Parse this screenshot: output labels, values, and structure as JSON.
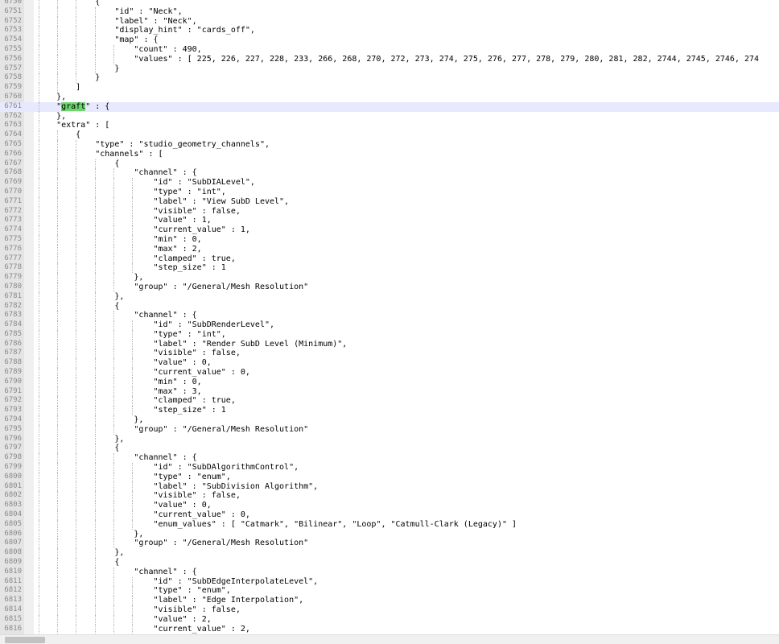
{
  "editor": {
    "search_term": "graft",
    "active_line": "6761",
    "lines": [
      {
        "n": "6750",
        "t": "            {"
      },
      {
        "n": "6751",
        "t": "                \"id\" : \"Neck\","
      },
      {
        "n": "6752",
        "t": "                \"label\" : \"Neck\","
      },
      {
        "n": "6753",
        "t": "                \"display_hint\" : \"cards_off\","
      },
      {
        "n": "6754",
        "t": "                \"map\" : {"
      },
      {
        "n": "6755",
        "t": "                    \"count\" : 490,"
      },
      {
        "n": "6756",
        "t": "                    \"values\" : [ 225, 226, 227, 228, 233, 266, 268, 270, 272, 273, 274, 275, 276, 277, 278, 279, 280, 281, 282, 2744, 2745, 2746, 274"
      },
      {
        "n": "6757",
        "t": "                }"
      },
      {
        "n": "6758",
        "t": "            }"
      },
      {
        "n": "6759",
        "t": "        ]"
      },
      {
        "n": "6760",
        "t": "    },"
      },
      {
        "n": "6761",
        "t": "    \"graft\" : {"
      },
      {
        "n": "6762",
        "t": "    },"
      },
      {
        "n": "6763",
        "t": "    \"extra\" : ["
      },
      {
        "n": "6764",
        "t": "        {"
      },
      {
        "n": "6765",
        "t": "            \"type\" : \"studio_geometry_channels\","
      },
      {
        "n": "6766",
        "t": "            \"channels\" : ["
      },
      {
        "n": "6767",
        "t": "                {"
      },
      {
        "n": "6768",
        "t": "                    \"channel\" : {"
      },
      {
        "n": "6769",
        "t": "                        \"id\" : \"SubDIALevel\","
      },
      {
        "n": "6770",
        "t": "                        \"type\" : \"int\","
      },
      {
        "n": "6771",
        "t": "                        \"label\" : \"View SubD Level\","
      },
      {
        "n": "6772",
        "t": "                        \"visible\" : false,"
      },
      {
        "n": "6773",
        "t": "                        \"value\" : 1,"
      },
      {
        "n": "6774",
        "t": "                        \"current_value\" : 1,"
      },
      {
        "n": "6775",
        "t": "                        \"min\" : 0,"
      },
      {
        "n": "6776",
        "t": "                        \"max\" : 2,"
      },
      {
        "n": "6777",
        "t": "                        \"clamped\" : true,"
      },
      {
        "n": "6778",
        "t": "                        \"step_size\" : 1"
      },
      {
        "n": "6779",
        "t": "                    },"
      },
      {
        "n": "6780",
        "t": "                    \"group\" : \"/General/Mesh Resolution\""
      },
      {
        "n": "6781",
        "t": "                },"
      },
      {
        "n": "6782",
        "t": "                {"
      },
      {
        "n": "6783",
        "t": "                    \"channel\" : {"
      },
      {
        "n": "6784",
        "t": "                        \"id\" : \"SubDRenderLevel\","
      },
      {
        "n": "6785",
        "t": "                        \"type\" : \"int\","
      },
      {
        "n": "6786",
        "t": "                        \"label\" : \"Render SubD Level (Minimum)\","
      },
      {
        "n": "6787",
        "t": "                        \"visible\" : false,"
      },
      {
        "n": "6788",
        "t": "                        \"value\" : 0,"
      },
      {
        "n": "6789",
        "t": "                        \"current_value\" : 0,"
      },
      {
        "n": "6790",
        "t": "                        \"min\" : 0,"
      },
      {
        "n": "6791",
        "t": "                        \"max\" : 3,"
      },
      {
        "n": "6792",
        "t": "                        \"clamped\" : true,"
      },
      {
        "n": "6793",
        "t": "                        \"step_size\" : 1"
      },
      {
        "n": "6794",
        "t": "                    },"
      },
      {
        "n": "6795",
        "t": "                    \"group\" : \"/General/Mesh Resolution\""
      },
      {
        "n": "6796",
        "t": "                },"
      },
      {
        "n": "6797",
        "t": "                {"
      },
      {
        "n": "6798",
        "t": "                    \"channel\" : {"
      },
      {
        "n": "6799",
        "t": "                        \"id\" : \"SubDAlgorithmControl\","
      },
      {
        "n": "6800",
        "t": "                        \"type\" : \"enum\","
      },
      {
        "n": "6801",
        "t": "                        \"label\" : \"SubDivision Algorithm\","
      },
      {
        "n": "6802",
        "t": "                        \"visible\" : false,"
      },
      {
        "n": "6803",
        "t": "                        \"value\" : 0,"
      },
      {
        "n": "6804",
        "t": "                        \"current_value\" : 0,"
      },
      {
        "n": "6805",
        "t": "                        \"enum_values\" : [ \"Catmark\", \"Bilinear\", \"Loop\", \"Catmull-Clark (Legacy)\" ]"
      },
      {
        "n": "6806",
        "t": "                    },"
      },
      {
        "n": "6807",
        "t": "                    \"group\" : \"/General/Mesh Resolution\""
      },
      {
        "n": "6808",
        "t": "                },"
      },
      {
        "n": "6809",
        "t": "                {"
      },
      {
        "n": "6810",
        "t": "                    \"channel\" : {"
      },
      {
        "n": "6811",
        "t": "                        \"id\" : \"SubDEdgeInterpolateLevel\","
      },
      {
        "n": "6812",
        "t": "                        \"type\" : \"enum\","
      },
      {
        "n": "6813",
        "t": "                        \"label\" : \"Edge Interpolation\","
      },
      {
        "n": "6814",
        "t": "                        \"visible\" : false,"
      },
      {
        "n": "6815",
        "t": "                        \"value\" : 2,"
      },
      {
        "n": "6816",
        "t": "                        \"current_value\" : 2,"
      }
    ]
  }
}
